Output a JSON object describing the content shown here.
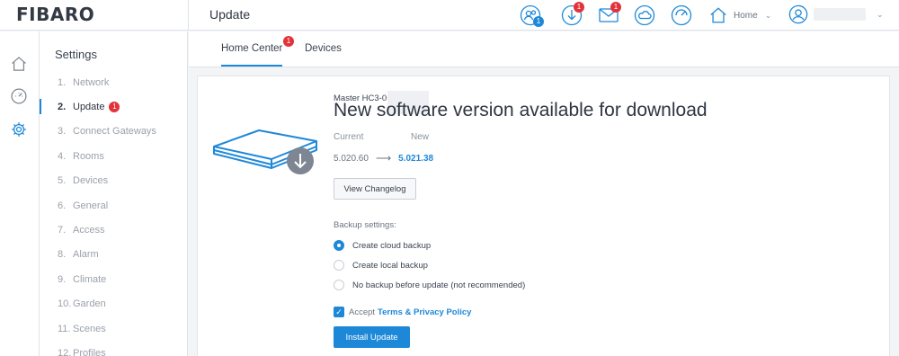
{
  "app": {
    "logo": "FIBARO",
    "page_title": "Update"
  },
  "topbar": {
    "icons": [
      {
        "name": "users-icon",
        "badge": "1",
        "badge_color": "blue"
      },
      {
        "name": "download-icon",
        "badge": "1",
        "badge_color": "red"
      },
      {
        "name": "mail-icon",
        "badge": "1",
        "badge_color": "red"
      },
      {
        "name": "cloud-icon",
        "badge": "",
        "badge_color": ""
      },
      {
        "name": "gauge-icon",
        "badge": "",
        "badge_color": ""
      }
    ],
    "home_label": "Home",
    "user_icon": "user-circle-icon"
  },
  "rail": [
    "home-icon",
    "dashboard-icon",
    "settings-gear-icon"
  ],
  "sidebar": {
    "title": "Settings",
    "items": [
      {
        "num": "1.",
        "label": "Network"
      },
      {
        "num": "2.",
        "label": "Update",
        "badge": "1"
      },
      {
        "num": "3.",
        "label": "Connect Gateways"
      },
      {
        "num": "4.",
        "label": "Rooms"
      },
      {
        "num": "5.",
        "label": "Devices"
      },
      {
        "num": "6.",
        "label": "General"
      },
      {
        "num": "7.",
        "label": "Access"
      },
      {
        "num": "8.",
        "label": "Alarm"
      },
      {
        "num": "9.",
        "label": "Climate"
      },
      {
        "num": "10.",
        "label": "Garden"
      },
      {
        "num": "11.",
        "label": "Scenes"
      },
      {
        "num": "12.",
        "label": "Profiles"
      }
    ]
  },
  "tabs": [
    {
      "label": "Home Center",
      "badge": "1"
    },
    {
      "label": "Devices"
    }
  ],
  "update": {
    "device_name": "Master HC3-0",
    "headline": "New software version available for download",
    "current_label": "Current",
    "new_label": "New",
    "current_version": "5.020.60",
    "arrow": "⟶",
    "new_version": "5.021.38",
    "changelog_button": "View Changelog",
    "backup_title": "Backup settings:",
    "backup_options": [
      {
        "label": "Create cloud backup",
        "selected": true
      },
      {
        "label": "Create local backup",
        "selected": false
      },
      {
        "label": "No backup before update (not recommended)",
        "selected": false
      }
    ],
    "accept_prefix": "Accept",
    "terms_link": "Terms & Privacy Policy",
    "install_button": "Install Update"
  },
  "colors": {
    "accent": "#1e88d8",
    "badge_red": "#e2333b"
  }
}
